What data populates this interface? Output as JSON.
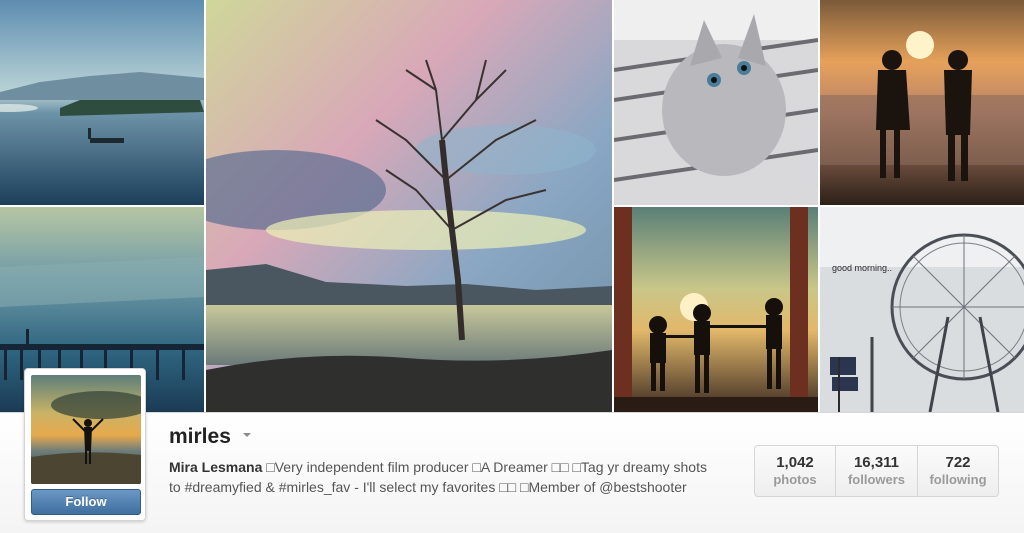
{
  "profile": {
    "username": "mirles",
    "full_name": "Mira Lesmana",
    "bio_text": " □Very independent film producer □A Dreamer □□ □Tag yr dreamy shots to #dreamyfied & #mirles_fav - I'll select my favorites □□ □Member of @bestshooter",
    "follow_label": "Follow"
  },
  "stats": [
    {
      "count": "1,042",
      "label": "photos"
    },
    {
      "count": "16,311",
      "label": "followers"
    },
    {
      "count": "722",
      "label": "following"
    }
  ],
  "photos": {
    "kitten_caption": "",
    "ferris_caption": "good morning.."
  },
  "colors": {
    "accent": "#4a7aab",
    "bar_background": "#f4f4f4",
    "label_gray": "#9a9a9a"
  },
  "icons": {
    "caret": "chevron-down-icon"
  }
}
